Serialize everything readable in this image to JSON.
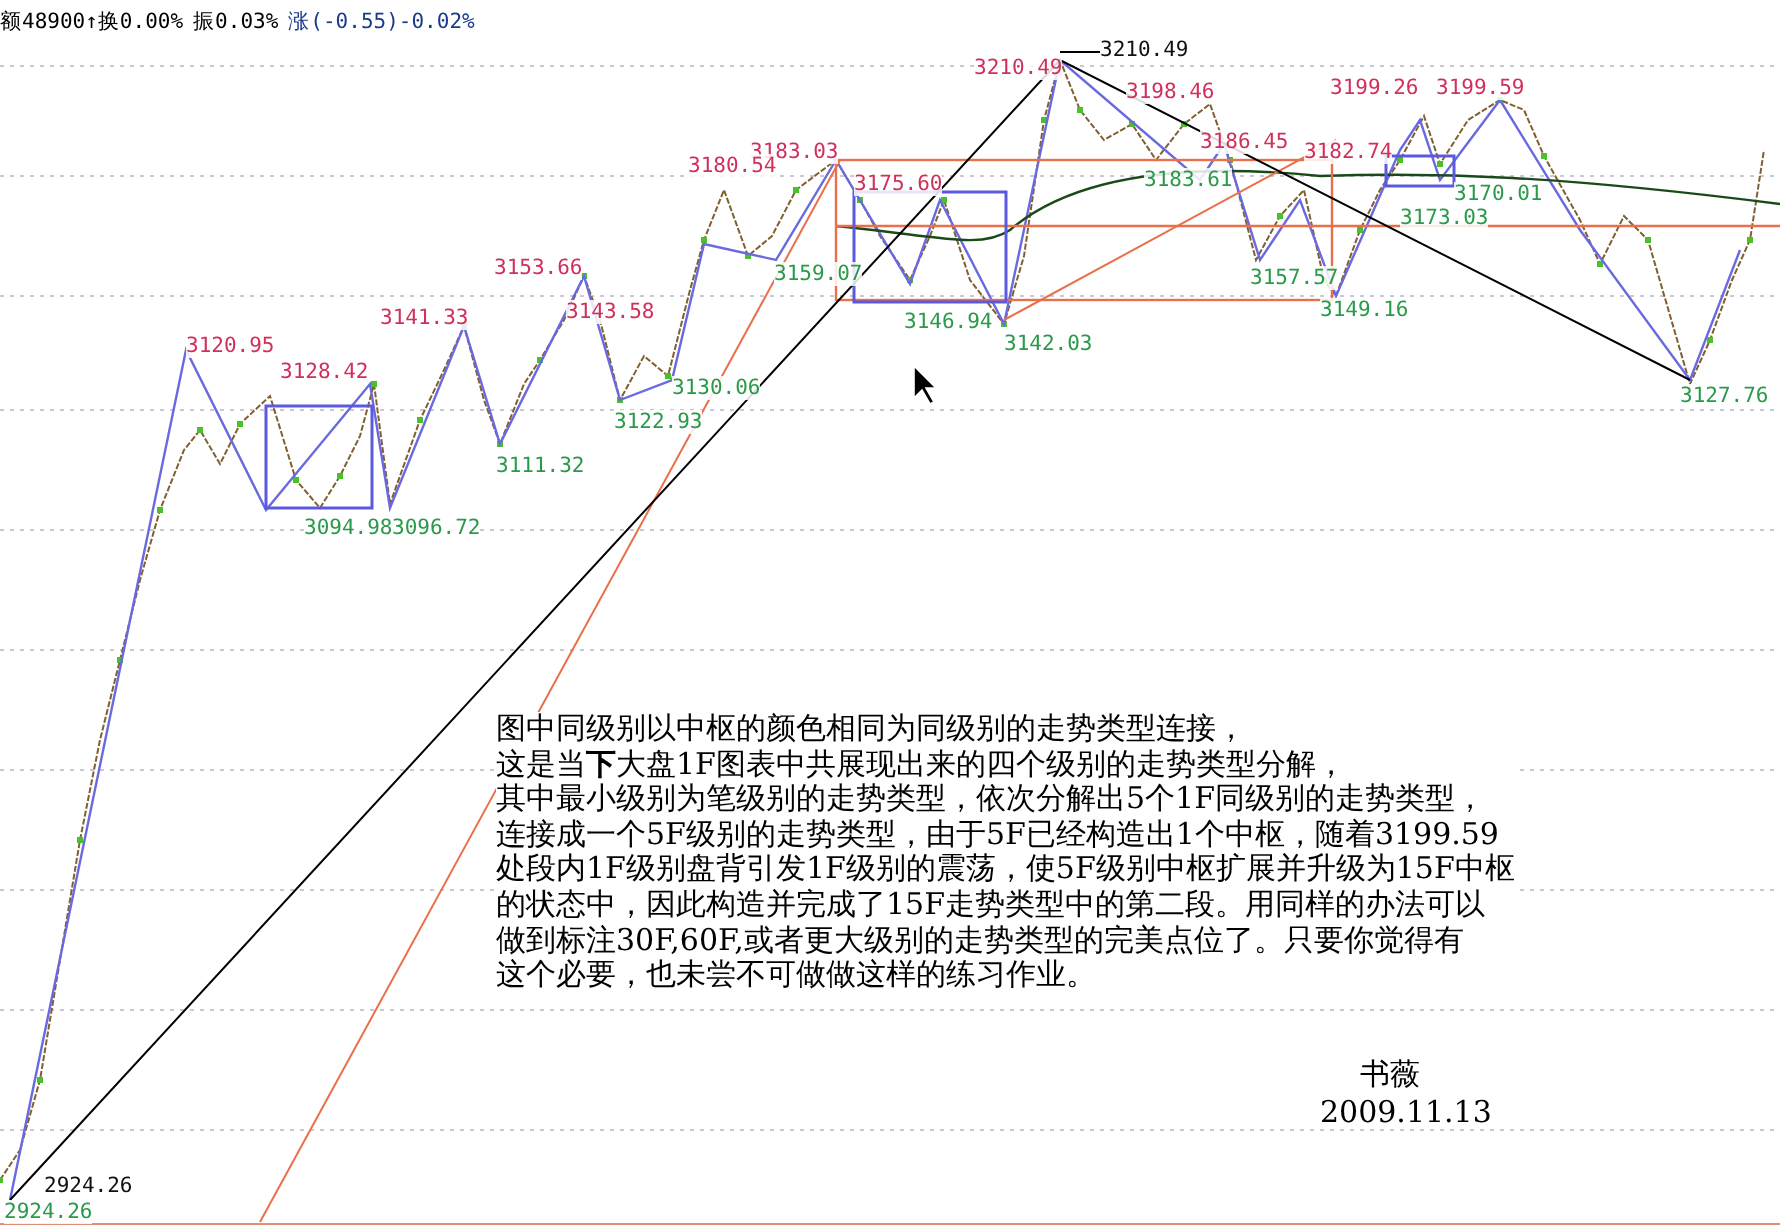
{
  "status_bar": [
    {
      "text": "额48900↑换0.00%",
      "kind": "plain"
    },
    {
      "text": "振0.03%",
      "kind": "plain"
    },
    {
      "text": "涨(-0.55)-0.02%",
      "kind": "change"
    }
  ],
  "price_labels": [
    {
      "text": "3210.49",
      "kind": "marker"
    },
    {
      "text": "3210.49",
      "kind": "high"
    },
    {
      "text": "3198.46",
      "kind": "high"
    },
    {
      "text": "3199.26",
      "kind": "high"
    },
    {
      "text": "3199.59",
      "kind": "high"
    },
    {
      "text": "3186.45",
      "kind": "high"
    },
    {
      "text": "3183.03",
      "kind": "high"
    },
    {
      "text": "3182.74",
      "kind": "high"
    },
    {
      "text": "3180.54",
      "kind": "high"
    },
    {
      "text": "3183.61",
      "kind": "low"
    },
    {
      "text": "3175.60",
      "kind": "high"
    },
    {
      "text": "3170.01",
      "kind": "low"
    },
    {
      "text": "3173.03",
      "kind": "low"
    },
    {
      "text": "3153.66",
      "kind": "high"
    },
    {
      "text": "3159.07",
      "kind": "low"
    },
    {
      "text": "3157.57",
      "kind": "low"
    },
    {
      "text": "3141.33",
      "kind": "high"
    },
    {
      "text": "3143.58",
      "kind": "high"
    },
    {
      "text": "3146.94",
      "kind": "low"
    },
    {
      "text": "3149.16",
      "kind": "low"
    },
    {
      "text": "3120.95",
      "kind": "high"
    },
    {
      "text": "3142.03",
      "kind": "low"
    },
    {
      "text": "3128.42",
      "kind": "high"
    },
    {
      "text": "3130.06",
      "kind": "low"
    },
    {
      "text": "3127.76",
      "kind": "low"
    },
    {
      "text": "3122.93",
      "kind": "low"
    },
    {
      "text": "3111.32",
      "kind": "low"
    },
    {
      "text": "3094.98",
      "kind": "low"
    },
    {
      "text": "3096.72",
      "kind": "low"
    },
    {
      "text": "2924.26",
      "kind": "marker"
    },
    {
      "text": "2924.26",
      "kind": "low"
    }
  ],
  "note": {
    "lines": [
      "图中同级别以中枢的颜色相同为同级别的走势类型连接，",
      "这是当**下**大盘1F图表中共展现出来的四个级别的走势类型分解，",
      "其中最小级别为笔级别的走势类型，依次分解出5个1F同级别的走势类型，",
      "连接成一个5F级别的走势类型，由于5F已经构造出1个中枢，随着3199.59",
      "处段内1F级别盘背引发1F级别的震荡，使5F级别中枢扩展并升级为15F中枢",
      "的状态中，因此构造并完成了15F走势类型中的第二段。用同样的办法可以",
      "做到标注30F,60F,或者更大级别的走势类型的完美点位了。只要你觉得有",
      "这个必要，也未尝不可做做这样的练习作业。"
    ],
    "author": "书薇",
    "date": "2009.11.13"
  }
}
